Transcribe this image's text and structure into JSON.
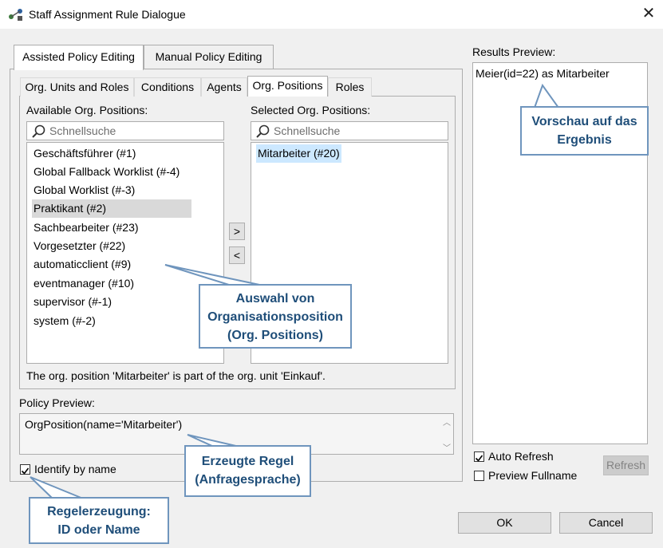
{
  "window": {
    "title": "Staff Assignment Rule Dialogue"
  },
  "tabs": [
    "Assisted Policy Editing",
    "Manual Policy Editing"
  ],
  "subtabs": [
    "Org. Units and Roles",
    "Conditions",
    "Agents",
    "Org. Positions",
    "Roles"
  ],
  "available": {
    "label": "Available Org. Positions:",
    "search_placeholder": "Schnellsuche",
    "items": [
      "Geschäftsführer (#1)",
      "Global Fallback Worklist (#-4)",
      "Global Worklist (#-3)",
      "Praktikant (#2)",
      "Sachbearbeiter (#23)",
      "Vorgesetzter (#22)",
      "automaticclient (#9)",
      "eventmanager (#10)",
      "supervisor (#-1)",
      "system (#-2)"
    ]
  },
  "move_buttons": {
    "add": ">",
    "remove": "<"
  },
  "selected": {
    "label": "Selected Org. Positions:",
    "search_placeholder": "Schnellsuche",
    "items": [
      "Mitarbeiter (#20)"
    ]
  },
  "info_text": "The org. position 'Mitarbeiter' is part of the org. unit 'Einkauf'.",
  "policy_preview": {
    "label": "Policy Preview:",
    "text": "OrgPosition(name='Mitarbeiter')"
  },
  "identify_by_name": {
    "label": "Identify by name",
    "checked": true
  },
  "results": {
    "label": "Results Preview:",
    "text": "Meier(id=22) as Mitarbeiter",
    "auto_refresh": {
      "label": "Auto Refresh",
      "checked": true
    },
    "preview_fullname": {
      "label": "Preview Fullname",
      "checked": false
    },
    "refresh_button": "Refresh"
  },
  "buttons": {
    "ok": "OK",
    "cancel": "Cancel"
  },
  "callouts": {
    "results": [
      "Vorschau auf das",
      "Ergebnis"
    ],
    "positions": [
      "Auswahl von",
      "Organisationsposition",
      "(Org. Positions)"
    ],
    "rule": [
      "Erzeugte Regel",
      "(Anfragesprache)"
    ],
    "idname": [
      "Regelerzeugung:",
      "ID oder Name"
    ]
  },
  "colors": {
    "callout_border": "#6f95bd",
    "callout_text": "#1f4e79",
    "selection_blue": "#cce8ff"
  }
}
